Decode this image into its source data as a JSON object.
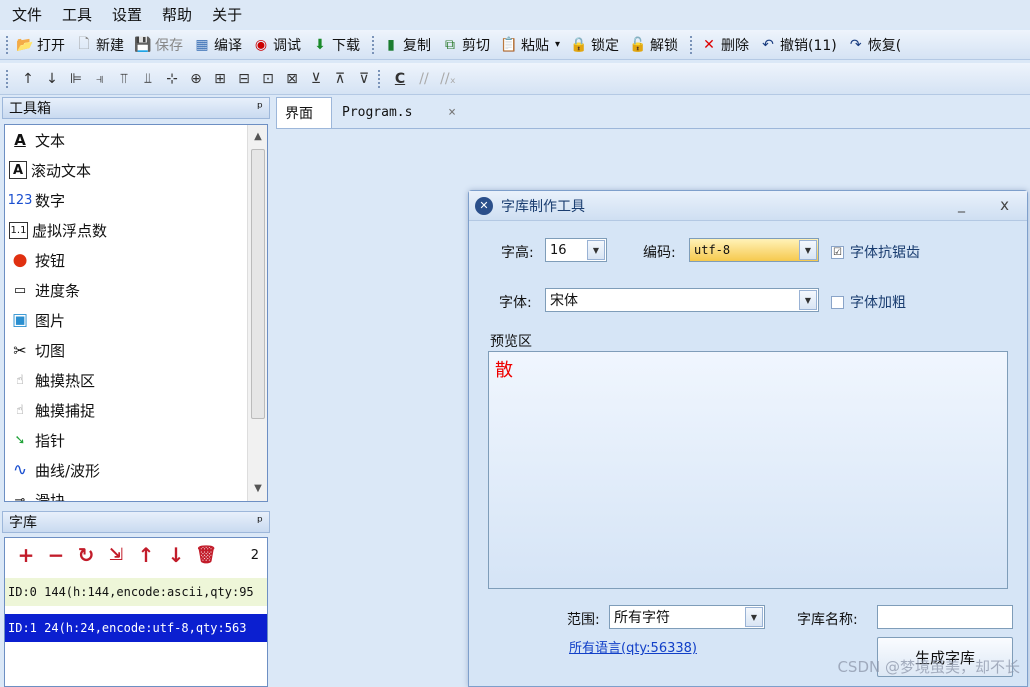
{
  "menu": [
    "文件",
    "工具",
    "设置",
    "帮助",
    "关于"
  ],
  "toolbar1": {
    "open": "打开",
    "new": "新建",
    "save": "保存",
    "compile": "编译",
    "debug": "调试",
    "download": "下载",
    "copy": "复制",
    "cut": "剪切",
    "paste": "粘贴",
    "lock": "锁定",
    "unlock": "解锁",
    "delete": "删除",
    "undo": "撤销(11)",
    "redo": "恢复("
  },
  "toolbar2": {
    "c_label": "C"
  },
  "toolbox": {
    "title": "工具箱",
    "pin": "ᵖ",
    "items": [
      {
        "icon": "A",
        "label": "文本"
      },
      {
        "icon": "A",
        "label": "滚动文本"
      },
      {
        "icon": "123",
        "label": "数字"
      },
      {
        "icon": "1.1",
        "label": "虚拟浮点数"
      },
      {
        "icon": "●",
        "label": "按钮"
      },
      {
        "icon": "▭",
        "label": "进度条"
      },
      {
        "icon": "▣",
        "label": "图片"
      },
      {
        "icon": "✂",
        "label": "切图"
      },
      {
        "icon": "☝",
        "label": "触摸热区"
      },
      {
        "icon": "☝",
        "label": "触摸捕捉"
      },
      {
        "icon": "➘",
        "label": "指针"
      },
      {
        "icon": "∿",
        "label": "曲线/波形"
      },
      {
        "icon": "⊸",
        "label": "滑块"
      }
    ]
  },
  "fontlib": {
    "title": "字库",
    "pin": "ᵖ",
    "count": "2",
    "rows": [
      {
        "text": "ID:0  144(h:144,encode:ascii,qty:95"
      },
      {
        "text": "ID:1  24(h:24,encode:utf-8,qty:563"
      }
    ]
  },
  "tabs": {
    "ui": "界面",
    "program": "Program.s",
    "close": "×"
  },
  "dialog": {
    "title": "字库制作工具",
    "minimize": "_",
    "close": "x",
    "height_label": "字高:",
    "height_value": "16",
    "encode_label": "编码:",
    "encode_value": "utf-8",
    "antialias_label": "字体抗锯齿",
    "antialias_checked": "☑",
    "font_label": "字体:",
    "font_value": "宋体",
    "bold_label": "字体加粗",
    "preview_label": "预览区",
    "preview_char": "散",
    "range_label": "范围:",
    "range_value": "所有字符",
    "name_label": "字库名称:",
    "name_value": "",
    "all_lang": "所有语言(qty:56338)",
    "generate": "生成字库"
  },
  "watermark": "CSDN @梦境虽美，却不长"
}
